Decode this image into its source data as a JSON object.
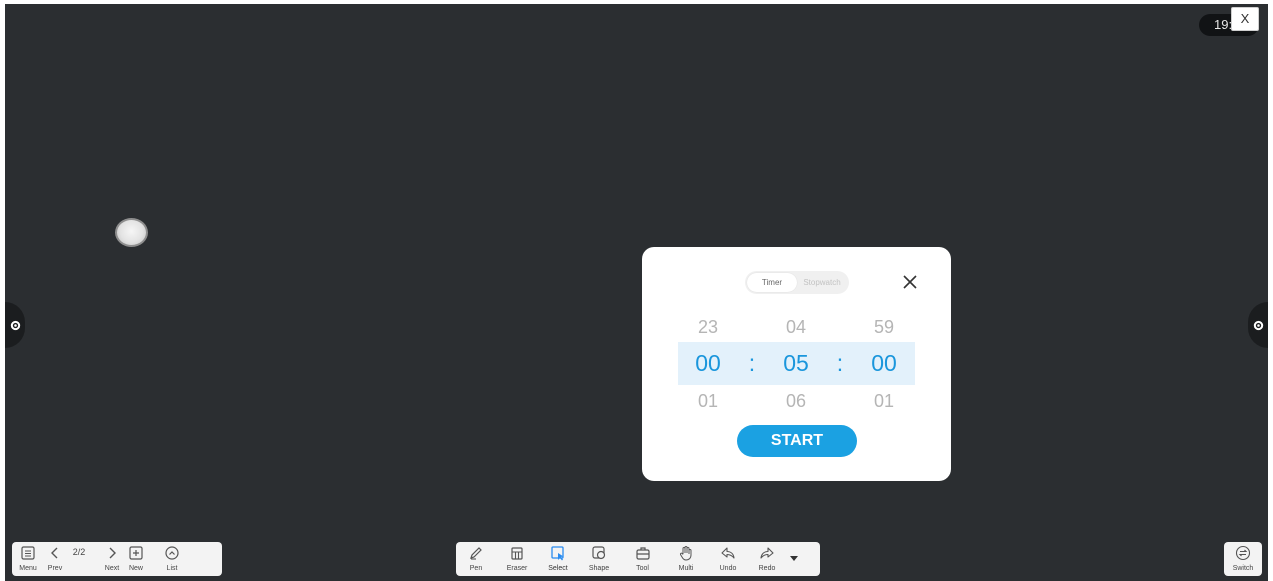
{
  "status": {
    "clock_text": "19:",
    "close_label": "X"
  },
  "timer_dialog": {
    "tabs": [
      {
        "label": "Timer",
        "active": true
      },
      {
        "label": "Stopwatch",
        "active": false
      }
    ],
    "prev_row": {
      "hours": "23",
      "minutes": "04",
      "seconds": "59"
    },
    "current_row": {
      "hours": "00",
      "minutes": "05",
      "seconds": "00"
    },
    "next_row": {
      "hours": "01",
      "minutes": "06",
      "seconds": "01"
    },
    "separator": ":",
    "start_label": "START"
  },
  "left_toolbar": {
    "menu_label": "Menu",
    "prev_label": "Prev",
    "page_indicator": "2/2",
    "next_label": "Next",
    "new_label": "New",
    "list_label": "List"
  },
  "center_toolbar": {
    "items": [
      {
        "label": "Pen",
        "icon": "pen-icon"
      },
      {
        "label": "Eraser",
        "icon": "eraser-icon"
      },
      {
        "label": "Select",
        "icon": "select-icon"
      },
      {
        "label": "Shape",
        "icon": "shape-icon"
      },
      {
        "label": "Tool",
        "icon": "toolbox-icon"
      },
      {
        "label": "Multi",
        "icon": "hand-icon"
      },
      {
        "label": "Undo",
        "icon": "undo-icon"
      },
      {
        "label": "Redo",
        "icon": "redo-icon"
      }
    ],
    "active_item": "Select"
  },
  "right_toolbar": {
    "switch_label": "Switch"
  },
  "colors": {
    "canvas_bg": "#2b2e31",
    "accent": "#1ba1e2",
    "selected_row_bg": "#e3f1fb",
    "selected_row_text": "#1a96dc",
    "select_icon": "#2a8cf0"
  }
}
